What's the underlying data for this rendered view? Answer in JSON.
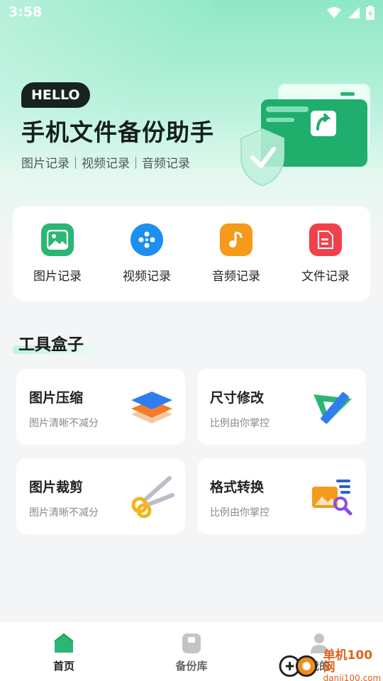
{
  "status_bar": {
    "time": "3:58"
  },
  "hero": {
    "badge": "HELLO",
    "title": "手机文件备份助手",
    "subtitle": "图片记录｜视频记录｜音频记录"
  },
  "quick_actions": [
    {
      "label": "图片记录",
      "icon": "image-icon",
      "color": "#2bb673"
    },
    {
      "label": "视频记录",
      "icon": "film-reel-icon",
      "color": "#1d8ff0"
    },
    {
      "label": "音频记录",
      "icon": "music-note-icon",
      "color": "#f59a1b"
    },
    {
      "label": "文件记录",
      "icon": "document-icon",
      "color": "#f2404b"
    }
  ],
  "tools_section": {
    "title": "工具盒子"
  },
  "tools": [
    {
      "name": "图片压缩",
      "desc": "图片清晰不减分",
      "icon": "layers-icon"
    },
    {
      "name": "尺寸修改",
      "desc": "比例由你掌控",
      "icon": "ruler-triangle-icon"
    },
    {
      "name": "图片裁剪",
      "desc": "图片清晰不减分",
      "icon": "scissors-icon"
    },
    {
      "name": "格式转换",
      "desc": "比例由你掌控",
      "icon": "image-convert-icon"
    }
  ],
  "bottom_nav": [
    {
      "label": "首页",
      "icon": "home-icon",
      "active": true
    },
    {
      "label": "备份库",
      "icon": "storage-icon",
      "active": false
    },
    {
      "label": "我的",
      "icon": "person-icon",
      "active": false
    }
  ],
  "watermark": {
    "line1": "单机100网",
    "line2": "danji100.com"
  },
  "colors": {
    "accent": "#2bb673",
    "nav_active": "#222222",
    "nav_inactive": "#9a9a9a"
  }
}
